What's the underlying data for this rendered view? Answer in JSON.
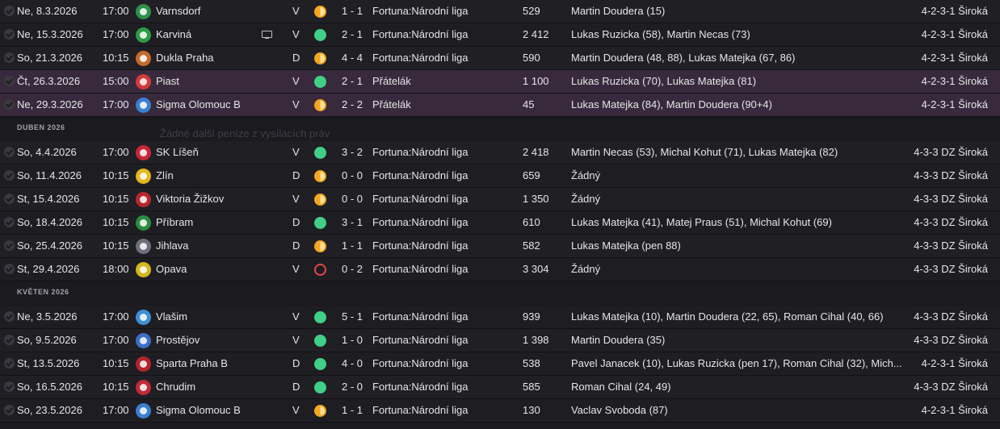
{
  "ghost_text": "Žádné další peníze z vysílacích práv",
  "items": [
    {
      "kind": "row",
      "date": "Ne, 8.3.2026",
      "time": "17:00",
      "badge": "#2f8f4a",
      "opponent": "Varnsdorf",
      "tv": false,
      "venue": "V",
      "result": "d",
      "score": "1 - 1",
      "competition": "Fortuna:Národní liga",
      "attendance": "529",
      "scorers": "Martin Doudera (15)",
      "formation": "4-2-3-1 Široká",
      "hl": false
    },
    {
      "kind": "row",
      "date": "Ne, 15.3.2026",
      "time": "17:00",
      "badge": "#2d9b45",
      "opponent": "Karviná",
      "tv": true,
      "venue": "V",
      "result": "w",
      "score": "2 - 1",
      "competition": "Fortuna:Národní liga",
      "attendance": "2 412",
      "scorers": "Lukas Ruzicka (58), Martin Necas (73)",
      "formation": "4-2-3-1 Široká",
      "hl": false
    },
    {
      "kind": "row",
      "date": "So, 21.3.2026",
      "time": "10:15",
      "badge": "#c46a2b",
      "opponent": "Dukla Praha",
      "tv": false,
      "venue": "D",
      "result": "d",
      "score": "4 - 4",
      "competition": "Fortuna:Národní liga",
      "attendance": "590",
      "scorers": "Martin Doudera (48, 88), Lukas Matejka (67, 86)",
      "formation": "4-2-3-1 Široká",
      "hl": false
    },
    {
      "kind": "row",
      "date": "Čt, 26.3.2026",
      "time": "15:00",
      "badge": "#d33a3a",
      "opponent": "Piast",
      "tv": false,
      "venue": "V",
      "result": "w",
      "score": "2 - 1",
      "competition": "Přátelák",
      "attendance": "1 100",
      "scorers": "Lukas Ruzicka (70), Lukas Matejka (81)",
      "formation": "4-2-3-1 Široká",
      "hl": true
    },
    {
      "kind": "row",
      "date": "Ne, 29.3.2026",
      "time": "17:00",
      "badge": "#3a7fd1",
      "opponent": "Sigma Olomouc B",
      "tv": false,
      "venue": "V",
      "result": "d",
      "score": "2 - 2",
      "competition": "Přátelák",
      "attendance": "45",
      "scorers": "Lukas Matejka (84), Martin Doudera (90+4)",
      "formation": "4-2-3-1 Široká",
      "hl": true
    },
    {
      "kind": "header",
      "label": "DUBEN 2026"
    },
    {
      "kind": "row",
      "date": "So, 4.4.2026",
      "time": "17:00",
      "badge": "#c8283a",
      "opponent": "SK Líšeň",
      "tv": false,
      "venue": "V",
      "result": "w",
      "score": "3 - 2",
      "competition": "Fortuna:Národní liga",
      "attendance": "2 418",
      "scorers": "Martin Necas (53), Michal Kohut (71), Lukas Matejka (82)",
      "formation": "4-3-3 DZ Široká",
      "hl": false
    },
    {
      "kind": "row",
      "date": "So, 11.4.2026",
      "time": "10:15",
      "badge": "#e3b81f",
      "opponent": "Zlín",
      "tv": false,
      "venue": "D",
      "result": "d",
      "score": "0 - 0",
      "competition": "Fortuna:Národní liga",
      "attendance": "659",
      "scorers": "Žádný",
      "formation": "4-3-3 DZ Široká",
      "hl": false
    },
    {
      "kind": "row",
      "date": "St, 15.4.2026",
      "time": "10:15",
      "badge": "#b8282f",
      "opponent": "Viktoria Žižkov",
      "tv": false,
      "venue": "V",
      "result": "d",
      "score": "0 - 0",
      "competition": "Fortuna:Národní liga",
      "attendance": "1 350",
      "scorers": "Žádný",
      "formation": "4-3-3 DZ Široká",
      "hl": false
    },
    {
      "kind": "row",
      "date": "So, 18.4.2026",
      "time": "10:15",
      "badge": "#2c8b3f",
      "opponent": "Příbram",
      "tv": false,
      "venue": "D",
      "result": "w",
      "score": "3 - 1",
      "competition": "Fortuna:Národní liga",
      "attendance": "610",
      "scorers": "Lukas Matejka (41), Matej Praus (51), Michal Kohut (69)",
      "formation": "4-3-3 DZ Široká",
      "hl": false
    },
    {
      "kind": "row",
      "date": "So, 25.4.2026",
      "time": "10:15",
      "badge": "#6b6f7a",
      "opponent": "Jihlava",
      "tv": false,
      "venue": "D",
      "result": "d",
      "score": "1 - 1",
      "competition": "Fortuna:Národní liga",
      "attendance": "582",
      "scorers": "Lukas Matejka (pen 88)",
      "formation": "4-3-3 DZ Široká",
      "hl": false
    },
    {
      "kind": "row",
      "date": "St, 29.4.2026",
      "time": "18:00",
      "badge": "#d6b61e",
      "opponent": "Opava",
      "tv": false,
      "venue": "V",
      "result": "l",
      "score": "0 - 2",
      "competition": "Fortuna:Národní liga",
      "attendance": "3 304",
      "scorers": "Žádný",
      "formation": "4-3-3 DZ Široká",
      "hl": false
    },
    {
      "kind": "header",
      "label": "KVĚTEN 2026"
    },
    {
      "kind": "row",
      "date": "Ne, 3.5.2026",
      "time": "17:00",
      "badge": "#3f8fd6",
      "opponent": "Vlašim",
      "tv": false,
      "venue": "V",
      "result": "w",
      "score": "5 - 1",
      "competition": "Fortuna:Národní liga",
      "attendance": "939",
      "scorers": "Lukas Matejka (10), Martin Doudera (22, 65), Roman Cihal (40, 66)",
      "formation": "4-3-3 DZ Široká",
      "hl": false
    },
    {
      "kind": "row",
      "date": "So, 9.5.2026",
      "time": "17:00",
      "badge": "#3b6fc4",
      "opponent": "Prostějov",
      "tv": false,
      "venue": "V",
      "result": "w",
      "score": "1 - 0",
      "competition": "Fortuna:Národní liga",
      "attendance": "1 398",
      "scorers": "Martin Doudera (35)",
      "formation": "4-3-3 DZ Široká",
      "hl": false
    },
    {
      "kind": "row",
      "date": "St, 13.5.2026",
      "time": "10:15",
      "badge": "#b3232f",
      "opponent": "Sparta Praha B",
      "tv": false,
      "venue": "D",
      "result": "w",
      "score": "4 - 0",
      "competition": "Fortuna:Národní liga",
      "attendance": "538",
      "scorers": "Pavel Janacek (10), Lukas Ruzicka (pen 17), Roman Cihal (32), Mich...",
      "formation": "4-2-3-1 Široká",
      "hl": false
    },
    {
      "kind": "row",
      "date": "So, 16.5.2026",
      "time": "10:15",
      "badge": "#c22a3a",
      "opponent": "Chrudim",
      "tv": false,
      "venue": "D",
      "result": "w",
      "score": "2 - 0",
      "competition": "Fortuna:Národní liga",
      "attendance": "585",
      "scorers": "Roman Cihal (24, 49)",
      "formation": "4-3-3 DZ Široká",
      "hl": false
    },
    {
      "kind": "row",
      "date": "So, 23.5.2026",
      "time": "17:00",
      "badge": "#3a7fd1",
      "opponent": "Sigma Olomouc B",
      "tv": false,
      "venue": "V",
      "result": "d",
      "score": "1 - 1",
      "competition": "Fortuna:Národní liga",
      "attendance": "130",
      "scorers": "Vaclav Svoboda (87)",
      "formation": "4-2-3-1 Široká",
      "hl": false
    }
  ]
}
